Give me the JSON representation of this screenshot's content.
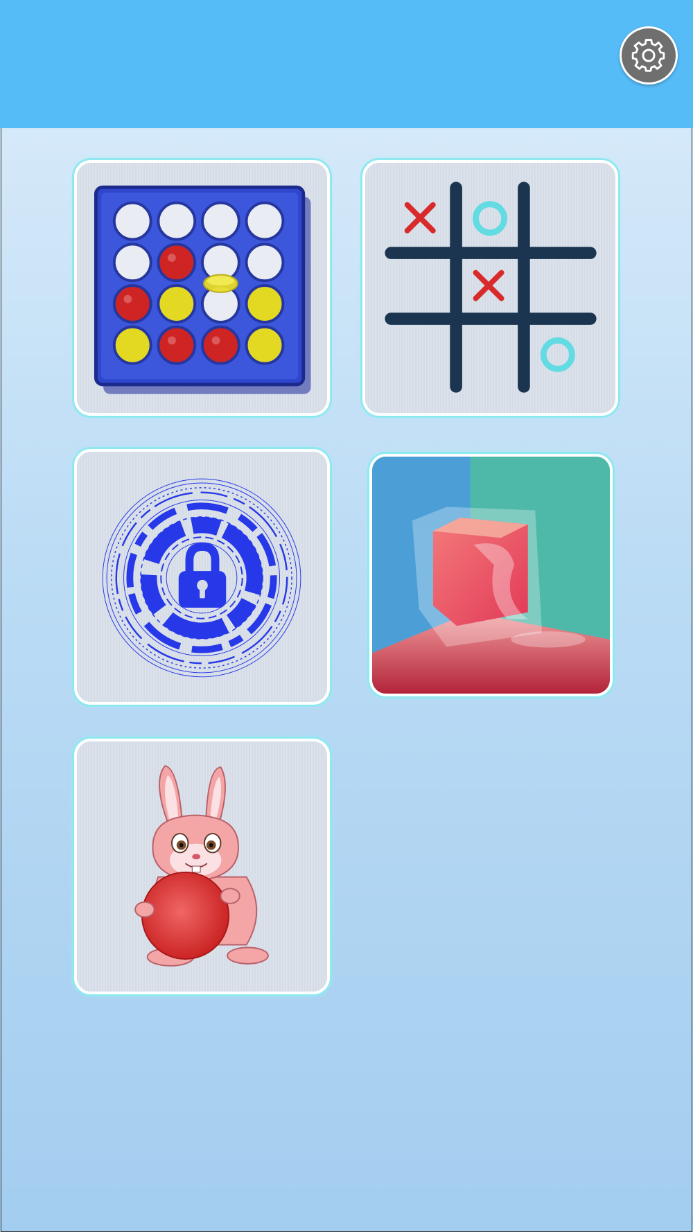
{
  "header": {
    "background_color": "#56bcf8",
    "settings_icon": "gear-icon"
  },
  "games": [
    {
      "id": "connect-four",
      "icon": "connect-four-board-icon"
    },
    {
      "id": "tic-tac-toe",
      "icon": "tic-tac-toe-icon"
    },
    {
      "id": "lock-puzzle",
      "icon": "padlock-circle-icon"
    },
    {
      "id": "jelly-cube",
      "icon": "jelly-cube-icon"
    },
    {
      "id": "bunny-ball",
      "icon": "bunny-with-ball-icon"
    }
  ],
  "colors": {
    "tile_border": "#8fe8f0",
    "accent_red": "#d32a2a",
    "accent_blue": "#2638e8",
    "accent_cyan": "#63dbe3"
  }
}
